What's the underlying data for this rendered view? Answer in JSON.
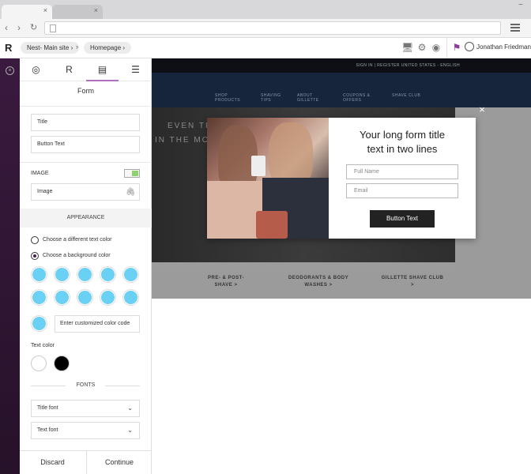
{
  "app": {
    "breadcrumbs": [
      "Nest- Main site",
      "Homepage"
    ],
    "user_name": "Jonathan Friedman"
  },
  "panel": {
    "title": "Form",
    "fields": {
      "title": "Title",
      "button_text": "Button Text"
    },
    "image_label": "IMAGE",
    "image_field": "Image",
    "image_toggle_on": true,
    "appearance_label": "APPEARANCE",
    "radio_text_color": "Choose a different text color",
    "radio_background_color": "Choose a background color",
    "selected_radio": "background",
    "swatch_color": "#6ad0f4",
    "custom_color_placeholder": "Enter customized color code",
    "text_color_label": "Text color",
    "text_colors": [
      "#ffffff",
      "#000000"
    ],
    "fonts_label": "FONTS",
    "title_font": "Title font",
    "text_font": "Text font",
    "discard": "Discard",
    "continue": "Continue"
  },
  "site": {
    "top_links": "SIGN IN  |  REGISTER     UNITED STATES - ENGLISH",
    "nav": [
      "SHOP PRODUCTS",
      "SHAVING TIPS",
      "ABOUT GILLETTE",
      "COUPONS & OFFERS",
      "SHAVE CLUB"
    ],
    "hero_lines": [
      "EVEN TH",
      "IN THE MO"
    ],
    "categories": [
      "PRE- & POST- SHAVE >",
      "DEODORANTS & BODY WASHES >",
      "GILLETTE SHAVE CLUB >"
    ]
  },
  "popup": {
    "title_line1": "Your long form title",
    "title_line2": "text in two lines",
    "full_name_placeholder": "Full Name",
    "email_placeholder": "Email",
    "button": "Button Text"
  },
  "colors": {
    "accent": "#b16fc2",
    "sidebar": "#2f1634",
    "toggle": "#8fd46a"
  }
}
